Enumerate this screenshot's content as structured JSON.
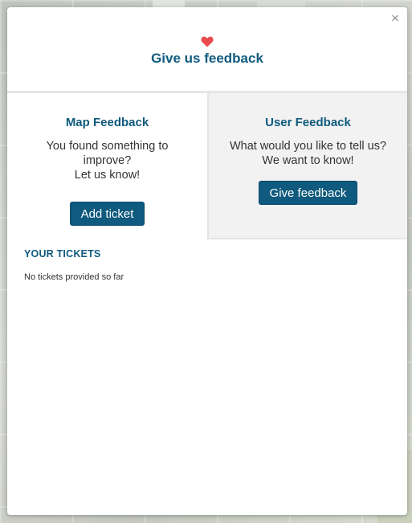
{
  "modal": {
    "close_label": "×",
    "title": "Give us feedback",
    "heart_color": "#e84c4f",
    "accent_color": "#0f5a7e"
  },
  "map_feedback": {
    "title": "Map Feedback",
    "text": "You found something to improve?\nLet us know!",
    "button_label": "Add ticket"
  },
  "user_feedback": {
    "title": "User Feedback",
    "text": "What would you like to tell us?\nWe want to know!",
    "button_label": "Give feedback"
  },
  "tickets": {
    "heading": "YOUR TICKETS",
    "empty_text": "No tickets provided so far"
  }
}
